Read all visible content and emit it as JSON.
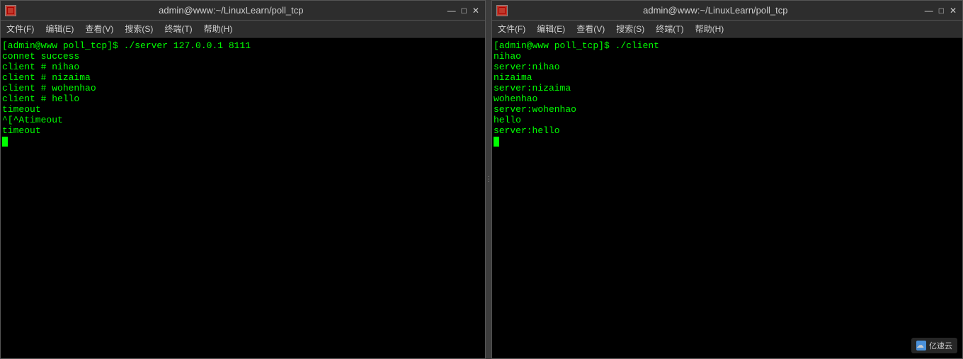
{
  "left_window": {
    "title": "admin@www:~/LinuxLearn/poll_tcp",
    "menu": [
      "文件(F)",
      "编辑(E)",
      "查看(V)",
      "搜索(S)",
      "终端(T)",
      "帮助(H)"
    ],
    "content": [
      "[admin@www poll_tcp]$ ./server 127.0.0.1 8111",
      "connet success",
      "client # nihao",
      "client # nizaima",
      "client # wohenhao",
      "client # hello",
      "timeout",
      "^[^Atimeout",
      "timeout",
      ""
    ]
  },
  "right_window": {
    "title": "admin@www:~/LinuxLearn/poll_tcp",
    "menu": [
      "文件(F)",
      "编辑(E)",
      "查看(V)",
      "搜索(S)",
      "终端(T)",
      "帮助(H)"
    ],
    "content": [
      "[admin@www poll_tcp]$ ./client",
      "nihao",
      "server:nihao",
      "nizaima",
      "server:nizaima",
      "wohenhao",
      "server:wohenhao",
      "hello",
      "server:hello",
      ""
    ]
  },
  "watermark": {
    "text": "亿速云",
    "icon": "cloud"
  }
}
